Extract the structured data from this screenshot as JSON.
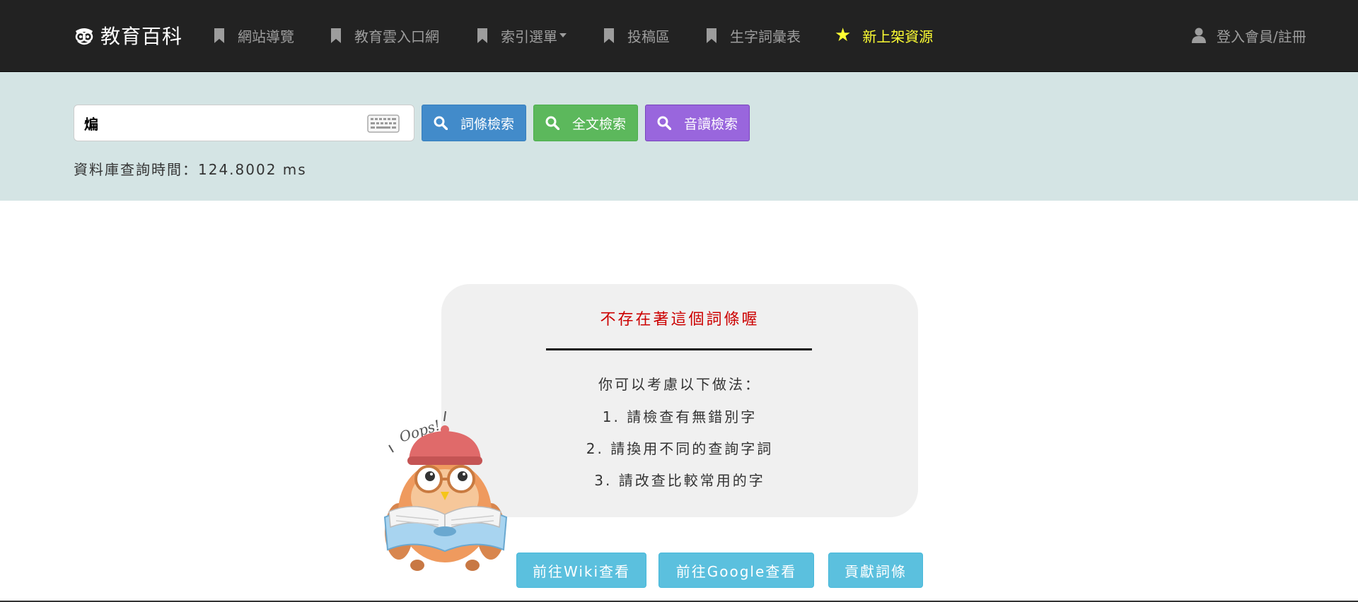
{
  "navbar": {
    "brand": "教育百科",
    "items": [
      {
        "label": "網站導覽",
        "icon": "bookmark-icon"
      },
      {
        "label": "教育雲入口網",
        "icon": "bookmark-icon"
      },
      {
        "label": "索引選單",
        "icon": "bookmark-icon",
        "dropdown": true
      },
      {
        "label": "投稿區",
        "icon": "bookmark-icon"
      },
      {
        "label": "生字詞彙表",
        "icon": "bookmark-icon"
      },
      {
        "label": "新上架資源",
        "icon": "star-icon",
        "color": "#ffff33"
      }
    ],
    "login_label": "登入會員/註冊"
  },
  "search": {
    "value": "煸",
    "buttons": {
      "term": "詞條檢索",
      "fulltext": "全文檢索",
      "phonetic": "音讀檢索"
    },
    "query_time": "資料庫查詢時間：124.8002 ms"
  },
  "result": {
    "title": "不存在著這個詞條喔",
    "lead": "你可以考慮以下做法：",
    "suggestions": [
      "1. 請檢查有無錯別字",
      "2. 請換用不同的查詢字詞",
      "3. 請改查比較常用的字"
    ],
    "owl_caption": "Oops!"
  },
  "actions": {
    "wiki": "前往Wiki查看",
    "google": "前往Google查看",
    "contribute": "貢獻詞條"
  },
  "colors": {
    "navbar_bg": "#222222",
    "search_band_bg": "#d4e4e4",
    "btn_blue": "#428bca",
    "btn_green": "#5cb85c",
    "btn_purple": "#9966dd",
    "btn_info": "#5bc0de",
    "error_text": "#cc0000",
    "highlight": "#ffff33"
  }
}
